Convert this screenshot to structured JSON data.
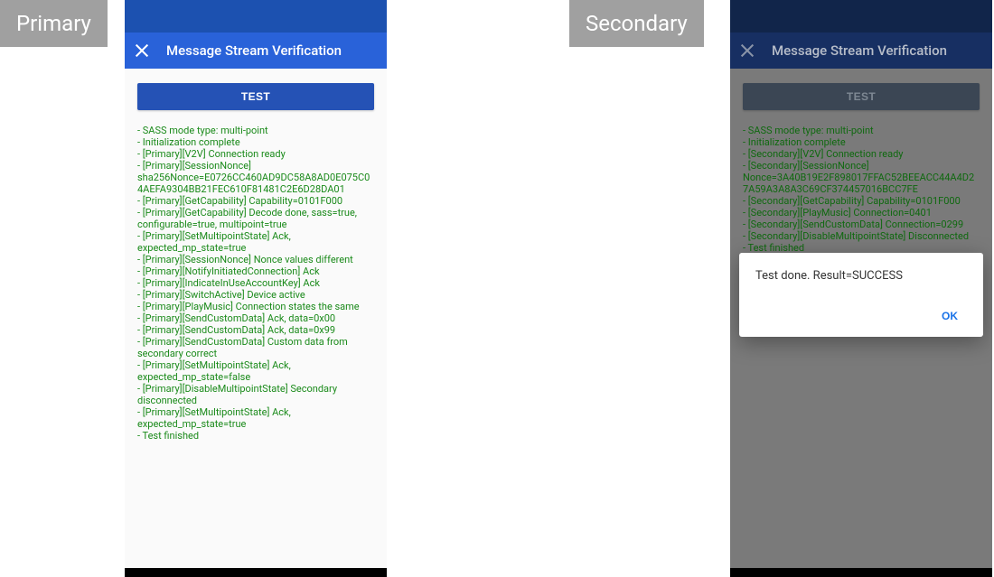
{
  "left_badge": "Primary",
  "right_badge": "Secondary",
  "left": {
    "appbar_title": "Message Stream Verification",
    "test_button": "TEST",
    "log_lines": [
      " - SASS mode type: multi-point",
      " - Initialization complete",
      " - [Primary][V2V] Connection ready",
      " - [Primary][SessionNonce] sha256Nonce=E0726CC460AD9DC58A8AD0E075C04AEFA9304BB21FEC610F81481C2E6D28DA01",
      " - [Primary][GetCapability] Capability=0101F000",
      " - [Primary][GetCapability] Decode done, sass=true, configurable=true, multipoint=true",
      " - [Primary][SetMultipointState] Ack, expected_mp_state=true",
      " - [Primary][SessionNonce] Nonce values different",
      " - [Primary][NotifyInitiatedConnection] Ack",
      " - [Primary][IndicateInUseAccountKey] Ack",
      " - [Primary][SwitchActive] Device active",
      " - [Primary][PlayMusic] Connection states the same",
      " - [Primary][SendCustomData] Ack, data=0x00",
      " - [Primary][SendCustomData] Ack, data=0x99",
      " - [Primary][SendCustomData] Custom data from secondary correct",
      " - [Primary][SetMultipointState] Ack, expected_mp_state=false",
      " - [Primary][DisableMultipointState] Secondary disconnected",
      " - [Primary][SetMultipointState] Ack, expected_mp_state=true",
      " - Test finished"
    ]
  },
  "right": {
    "appbar_title": "Message Stream Verification",
    "test_button": "TEST",
    "log_lines": [
      " - SASS mode type: multi-point",
      " - Initialization complete",
      " - [Secondary][V2V] Connection ready",
      " - [Secondary][SessionNonce] Nonce=3A40B19E2F898017FFAC52BEEACC44A4D27A59A3A8A3C69CF374457016BCC7FE",
      " - [Secondary][GetCapability] Capability=0101F000",
      " - [Secondary][PlayMusic] Connection=0401",
      " - [Secondary][SendCustomData] Connection=0299",
      " - [Secondary][DisableMultipointState] Disconnected",
      " - Test finished"
    ],
    "dialog": {
      "message": "Test done. Result=SUCCESS",
      "ok": "OK"
    }
  }
}
